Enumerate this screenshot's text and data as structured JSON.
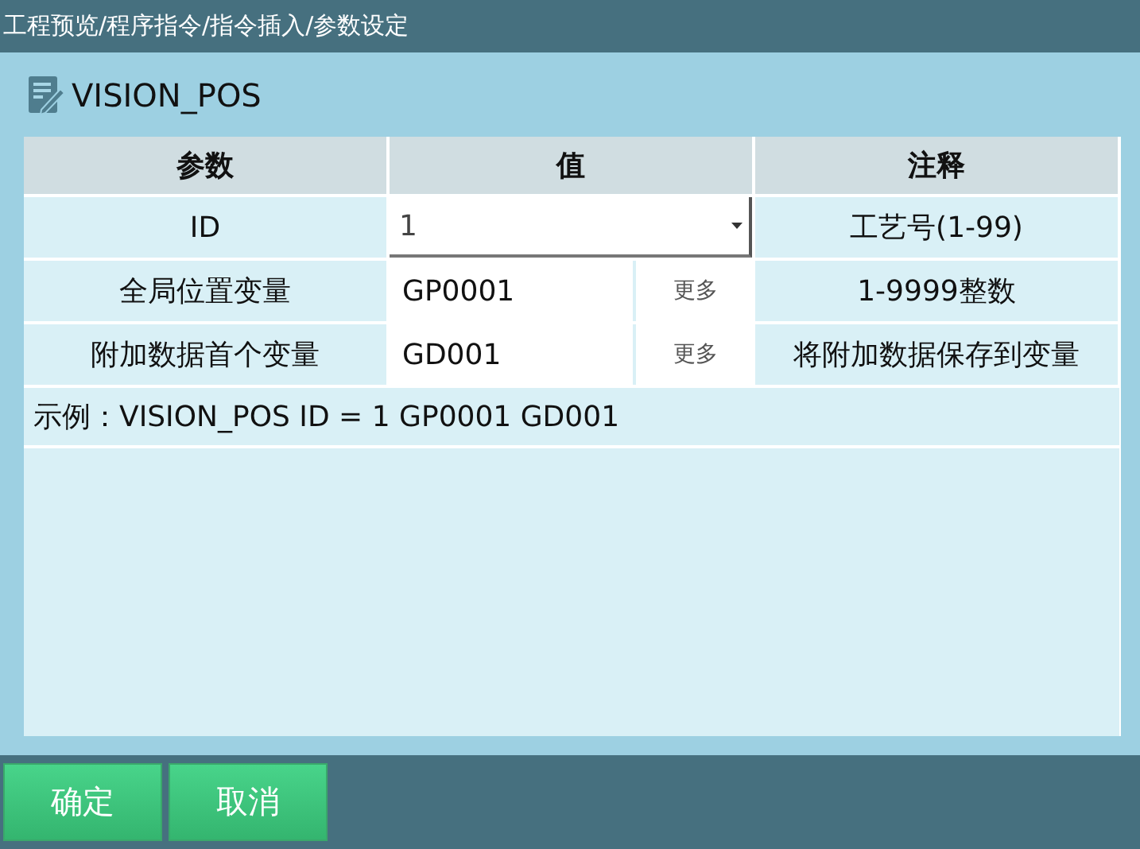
{
  "window": {
    "title": "工程预览/程序指令/指令插入/参数设定"
  },
  "instruction": {
    "name": "VISION_POS"
  },
  "table": {
    "columns": [
      "参数",
      "值",
      "注释"
    ],
    "rows": [
      {
        "kind": "dropdown",
        "param": "ID",
        "value": "1",
        "note": "工艺号(1-99)"
      },
      {
        "kind": "text_more",
        "param": "全局位置变量",
        "value": "GP0001",
        "button": "更多",
        "note": "1-9999整数"
      },
      {
        "kind": "text_more",
        "param": "附加数据首个变量",
        "value": "GD001",
        "button": "更多",
        "note": "将附加数据保存到变量"
      }
    ],
    "example": "示例：VISION_POS ID = 1 GP0001 GD001"
  },
  "buttons": [
    "确定",
    "取消"
  ]
}
